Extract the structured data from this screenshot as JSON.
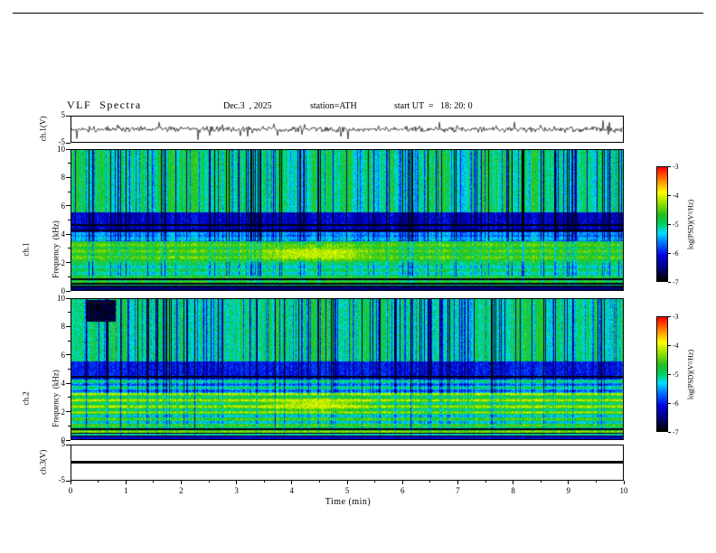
{
  "header": {
    "title": "VLF  Spectra",
    "date": "Dec.3  , 2025",
    "station": "station=ATH",
    "start_ut": "start UT  =   18: 20: 0"
  },
  "axes": {
    "time": {
      "label": "Time  (min)",
      "min": 0,
      "max": 10,
      "major_ticks": [
        "0",
        "1",
        "2",
        "3",
        "4",
        "5",
        "6",
        "7",
        "8",
        "9",
        "10"
      ],
      "minor_step": 0.5
    },
    "frequency": {
      "label": "Frequency  (kHz)",
      "min": 0,
      "max": 10,
      "major_ticks": [
        "0",
        "2",
        "4",
        "6",
        "8",
        "10"
      ],
      "minor_step": 1
    },
    "voltage": {
      "min": -5,
      "max": 5,
      "top_tick": "5",
      "bottom_tick": "-5"
    }
  },
  "panels": {
    "ch1_wave": {
      "ylabel": "ch.1(V)"
    },
    "ch1_spec": {
      "ylabel_line1": "ch.1",
      "ylabel_line2": "Frequency  (kHz)"
    },
    "ch2_spec": {
      "ylabel_line1": "ch.2",
      "ylabel_line2": "Frequency  (kHz)"
    },
    "ch3_wave": {
      "ylabel": "ch.3(V)"
    }
  },
  "colorbar": {
    "label": "log(PSD)(V²/Hz)",
    "ticks": [
      "-3",
      "-4",
      "-5",
      "-6",
      "-7"
    ],
    "stops": [
      [
        0.0,
        "#000000"
      ],
      [
        0.1,
        "#000070"
      ],
      [
        0.22,
        "#0000e0"
      ],
      [
        0.33,
        "#0070ff"
      ],
      [
        0.42,
        "#00e0ff"
      ],
      [
        0.5,
        "#00d060"
      ],
      [
        0.58,
        "#20c020"
      ],
      [
        0.68,
        "#90e000"
      ],
      [
        0.78,
        "#ffff00"
      ],
      [
        0.88,
        "#ff9000"
      ],
      [
        1.0,
        "#ff0000"
      ]
    ]
  },
  "chart_data": [
    {
      "type": "line",
      "title": "ch.1 voltage waveform",
      "ylabel": "ch.1(V)",
      "xlabel": "Time (min)",
      "xlim": [
        0,
        10
      ],
      "ylim": [
        -5,
        5
      ],
      "description": "Continuous broadband noise trace centered on 0 V, rms about 0.6 V, with frequent impulsive sferic spikes reaching roughly ±4 V",
      "noise_rms": 0.55,
      "spike_probability": 0.035,
      "spike_amplitude": 2.6
    },
    {
      "type": "heatmap",
      "title": "ch.1 VLF spectrogram",
      "xlabel": "Time (min)",
      "ylabel": "Frequency (kHz)",
      "zlabel": "log(PSD)(V²/Hz)",
      "xlim": [
        0,
        10
      ],
      "ylim": [
        0,
        10
      ],
      "zlim": [
        -7,
        -3
      ],
      "bands": [
        {
          "f": [
            5.6,
            10.0
          ],
          "psd": -5.0,
          "streak": 1.0
        },
        {
          "f": [
            4.15,
            5.6
          ],
          "psd": -6.2,
          "streak": 0.45
        },
        {
          "f": [
            3.5,
            4.15
          ],
          "psd": -5.5,
          "streak": 0.55
        },
        {
          "f": [
            2.0,
            3.5
          ],
          "psd": -4.6,
          "streak": 0.3
        },
        {
          "f": [
            1.0,
            2.0
          ],
          "psd": -5.05,
          "streak": 0.4
        },
        {
          "f": [
            0.35,
            1.0
          ],
          "psd": -4.75,
          "streak": 0.25
        },
        {
          "f": [
            0.0,
            0.35
          ],
          "psd": -6.7,
          "streak": 0.05
        }
      ],
      "stripe_amp": 0.18,
      "stripe_max_khz": 4.0,
      "hot_patch": {
        "t": [
          3.0,
          5.8
        ],
        "f": [
          2.0,
          3.3
        ],
        "psd": -4.0
      },
      "dark_lines_khz": [
        0.5,
        0.8,
        4.3,
        4.65
      ],
      "streaks": "dense vertical striping from impulsive sferics, PSD dips of 1-2 decades above ~4 kHz, occasional full-height near-black columns"
    },
    {
      "type": "heatmap",
      "title": "ch.2 VLF spectrogram",
      "xlabel": "Time (min)",
      "ylabel": "Frequency (kHz)",
      "zlabel": "log(PSD)(V²/Hz)",
      "xlim": [
        0,
        10
      ],
      "ylim": [
        0,
        10
      ],
      "zlim": [
        -7,
        -3
      ],
      "bands": [
        {
          "f": [
            5.6,
            10.0
          ],
          "psd": -5.0,
          "streak": 1.0
        },
        {
          "f": [
            4.3,
            5.6
          ],
          "psd": -6.0,
          "streak": 0.4
        },
        {
          "f": [
            3.3,
            4.3
          ],
          "psd": -5.3,
          "streak": 0.5
        },
        {
          "f": [
            1.9,
            3.3
          ],
          "psd": -4.55,
          "streak": 0.3
        },
        {
          "f": [
            0.9,
            1.9
          ],
          "psd": -4.9,
          "streak": 0.35
        },
        {
          "f": [
            0.3,
            0.9
          ],
          "psd": -4.7,
          "streak": 0.2
        },
        {
          "f": [
            0.0,
            0.3
          ],
          "psd": -6.6,
          "streak": 0.05
        }
      ],
      "stripe_amp": 0.45,
      "stripe_max_khz": 4.3,
      "hot_patch": {
        "t": [
          3.2,
          5.6
        ],
        "f": [
          1.9,
          3.1
        ],
        "psd": -4.0
      },
      "dark_lines_khz": [
        0.45,
        0.75,
        4.5
      ],
      "black_blob": {
        "t": [
          0.25,
          0.8
        ],
        "f": [
          8.4,
          10.0
        ]
      },
      "streaks": "dense vertical striping as ch.1 plus pronounced horizontal banding below ~4 kHz and a black dropout patch near t=0.5 min above 8.4 kHz"
    },
    {
      "type": "line",
      "title": "ch.3 voltage waveform",
      "ylabel": "ch.3(V)",
      "xlabel": "Time (min)",
      "xlim": [
        0,
        10
      ],
      "ylim": [
        -5,
        5
      ],
      "value": 0,
      "description": "Flat thick line at 0 V (channel inactive)"
    }
  ]
}
